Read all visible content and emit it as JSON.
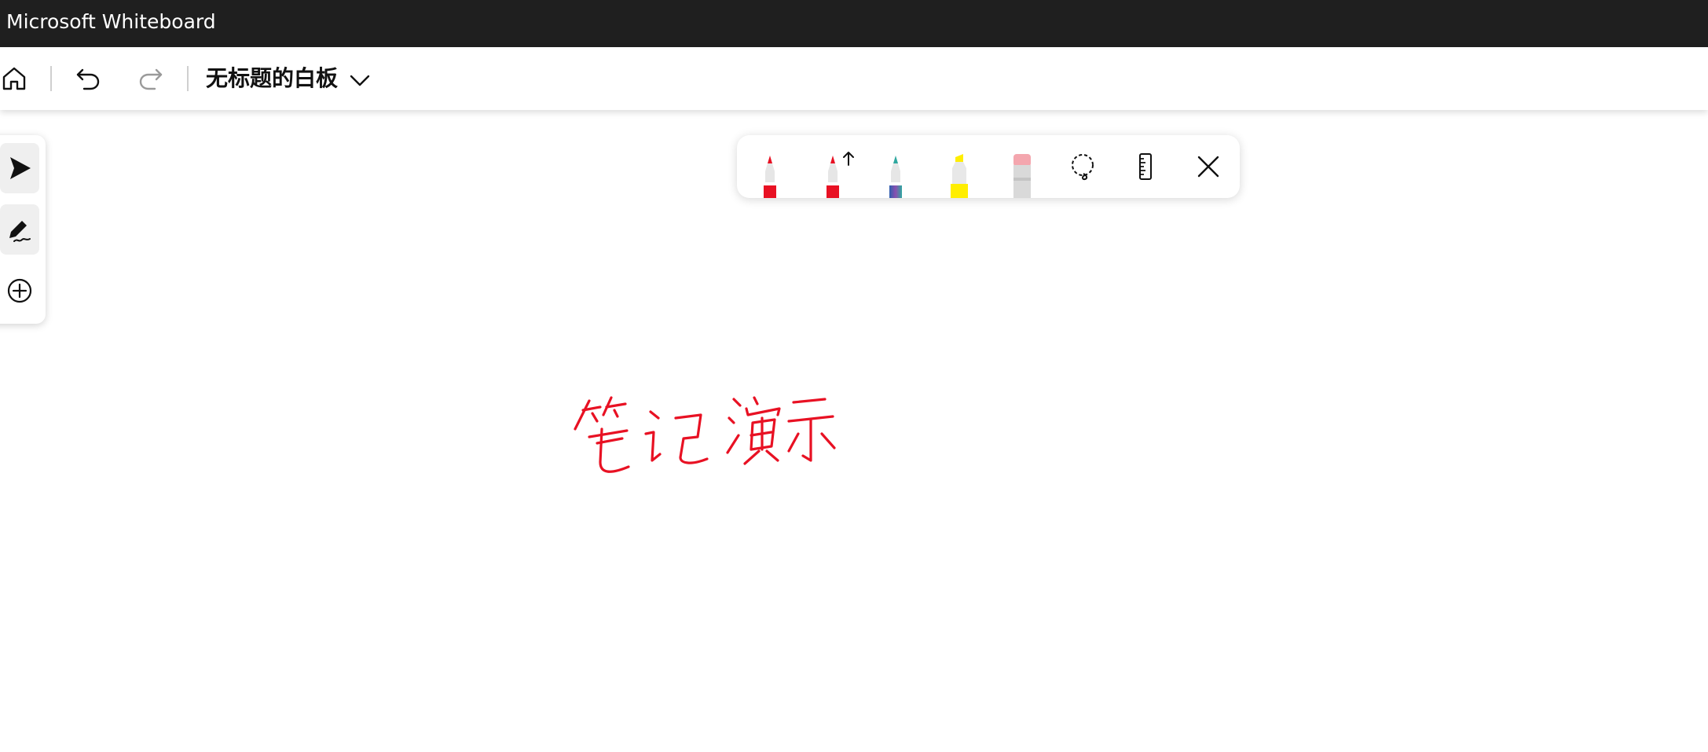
{
  "window": {
    "title": "Microsoft Whiteboard"
  },
  "toolbar": {
    "board_title": "无标题的白板",
    "icons": {
      "home": "home-icon",
      "undo": "undo-icon",
      "redo": "redo-icon",
      "chevron": "chevron-down-icon"
    },
    "redo_enabled": false
  },
  "left_rail": {
    "items": [
      {
        "name": "select-tool",
        "icon": "pointer-icon",
        "active": true
      },
      {
        "name": "ink-tool",
        "icon": "pen-scribble-icon",
        "active": true
      },
      {
        "name": "add-tool",
        "icon": "plus-circle-icon",
        "active": false
      }
    ]
  },
  "ink_toolbar": {
    "pens": [
      {
        "name": "red-pen",
        "icon": "pen-icon",
        "color": "#e81123"
      },
      {
        "name": "red-arrow-pen",
        "icon": "pen-arrow-icon",
        "color": "#e81123"
      },
      {
        "name": "galaxy-pen",
        "icon": "pen-icon",
        "color": "#5a5aa0"
      },
      {
        "name": "yellow-highlighter",
        "icon": "highlighter-icon",
        "color": "#ffee00"
      },
      {
        "name": "eraser",
        "icon": "eraser-icon",
        "color": "#f4a6ae"
      }
    ],
    "tools": [
      {
        "name": "lasso",
        "icon": "lasso-icon"
      },
      {
        "name": "ruler",
        "icon": "ruler-icon"
      },
      {
        "name": "close",
        "icon": "close-icon"
      }
    ]
  },
  "canvas": {
    "handwriting": "笔记演示",
    "ink_color": "#e81123"
  }
}
